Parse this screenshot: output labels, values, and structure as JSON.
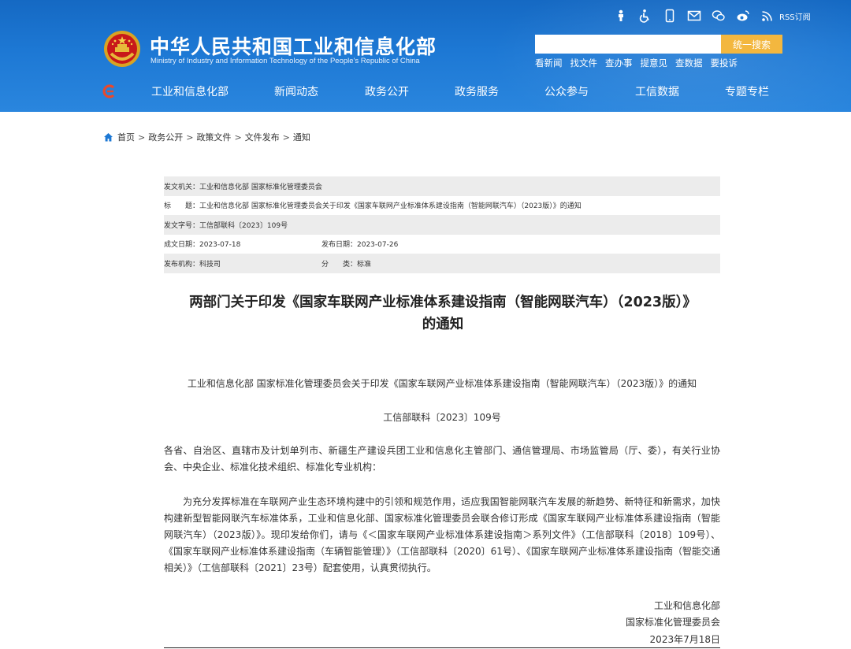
{
  "header": {
    "site_title": "中华人民共和国工业和信息化部",
    "site_subtitle": "Ministry of Industry and Information Technology of the People's Republic of China",
    "util_icons": [
      "elderly-mode-icon",
      "accessibility-icon",
      "mobile-icon",
      "mail-icon",
      "wechat-icon",
      "weibo-icon",
      "rss-icon"
    ],
    "rss_label": "RSS订阅",
    "search": {
      "value": "",
      "button_label": "统一搜索"
    },
    "quick_links": [
      "看新闻",
      "找文件",
      "查办事",
      "提意见",
      "查数据",
      "要投诉"
    ],
    "nav": [
      "工业和信息化部",
      "新闻动态",
      "政务公开",
      "政务服务",
      "公众参与",
      "工信数据",
      "专题专栏"
    ],
    "colors": {
      "header_blue": "#1d78d4",
      "search_button": "#f3b73f"
    }
  },
  "breadcrumb": [
    "首页",
    "政务公开",
    "政策文件",
    "文件发布",
    "通知"
  ],
  "info": {
    "issuer": "发文机关：工业和信息化部 国家标准化管理委员会",
    "title": "标　　题：工业和信息化部 国家标准化管理委员会关于印发《国家车联网产业标准体系建设指南（智能网联汽车）（2023版）》的通知",
    "doc_no": "发文字号：工信部联科〔2023〕109号",
    "created": "成文日期：2023-07-18",
    "published": "发布日期：2023-07-26",
    "agency": "发布机构：科技司",
    "category": "分　　类：标准"
  },
  "document": {
    "title_line1": "两部门关于印发《国家车联网产业标准体系建设指南（智能网联汽车）（2023版）》",
    "title_line2": "的通知",
    "heading": "工业和信息化部 国家标准化管理委员会关于印发《国家车联网产业标准体系建设指南（智能网联汽车）（2023版）》的通知",
    "number": "工信部联科〔2023〕109号",
    "para1": "各省、自治区、直辖市及计划单列市、新疆生产建设兵团工业和信息化主管部门、通信管理局、市场监管局（厅、委），有关行业协会、中央企业、标准化技术组织、标准化专业机构：",
    "para2": "为充分发挥标准在车联网产业生态环境构建中的引领和规范作用，适应我国智能网联汽车发展的新趋势、新特征和新需求，加快构建新型智能网联汽车标准体系，工业和信息化部、国家标准化管理委员会联合修订形成《国家车联网产业标准体系建设指南（智能网联汽车）（2023版）》。现印发给你们，请与《＜国家车联网产业标准体系建设指南＞系列文件》（工信部联科〔2018〕109号）、《国家车联网产业标准体系建设指南（车辆智能管理）》（工信部联科〔2020〕61号）、《国家车联网产业标准体系建设指南（智能交通相关）》（工信部联科〔2021〕23号）配套使用，认真贯彻执行。",
    "sign1": "工业和信息化部",
    "sign2": "国家标准化管理委员会",
    "date": "2023年7月18日"
  }
}
